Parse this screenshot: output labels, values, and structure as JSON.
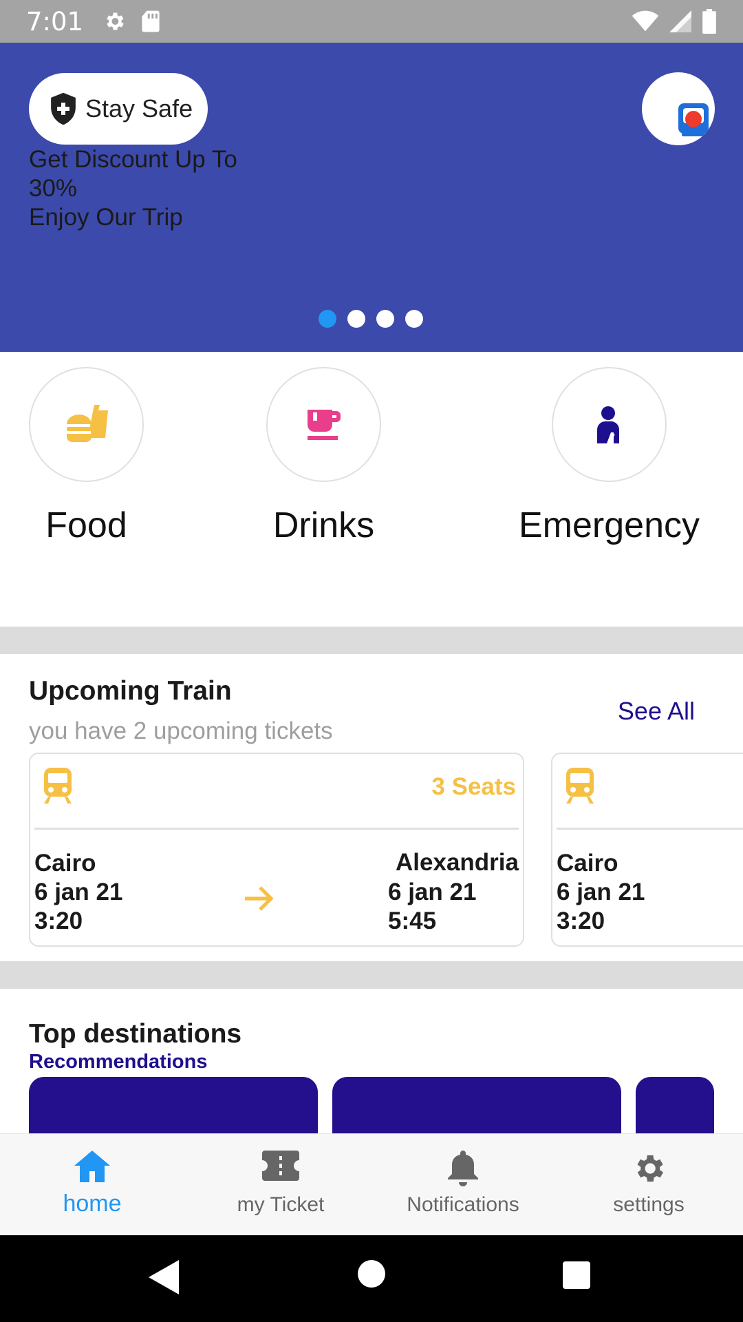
{
  "status_bar": {
    "time": "7:01",
    "icons": [
      "settings-icon",
      "sd-card-icon",
      "wifi-icon",
      "signal-icon",
      "battery-icon"
    ]
  },
  "hero": {
    "stay_safe_label": "Stay Safe",
    "promo_line1": "Get Discount Up To",
    "promo_line2": "30%",
    "promo_line3": "Enjoy Our Trip",
    "slides_total": 4,
    "active_slide": 1,
    "background_color": "#3c4aab"
  },
  "categories": [
    {
      "label": "Food",
      "icon": "food-icon",
      "color": "#f6c044"
    },
    {
      "label": "Drinks",
      "icon": "coffee-cup-icon",
      "color": "#e83e8c"
    },
    {
      "label": "Emergency",
      "icon": "emergency-person-icon",
      "color": "#1e0f8f"
    }
  ],
  "upcoming": {
    "title": "Upcoming Train",
    "subtitle": "you have 2 upcoming tickets",
    "see_all": "See All",
    "tickets": [
      {
        "seats": "3 Seats",
        "from_city": "Cairo",
        "from_date": "6 jan 21",
        "from_time": "3:20",
        "to_city": "Alexandria",
        "to_date": "6 jan 21",
        "to_time": "5:45"
      },
      {
        "seats": "",
        "from_city": "Cairo",
        "from_date": "6 jan 21",
        "from_time": "3:20"
      }
    ]
  },
  "destinations": {
    "title": "Top destinations",
    "subtitle": "Recommendations",
    "card_color": "#240f8c"
  },
  "bottom_nav": {
    "items": [
      {
        "label": "home",
        "icon": "home-icon",
        "active": true
      },
      {
        "label": "my Ticket",
        "icon": "ticket-icon",
        "active": false
      },
      {
        "label": "Notifications",
        "icon": "bell-icon",
        "active": false
      },
      {
        "label": "settings",
        "icon": "gear-icon",
        "active": false
      }
    ],
    "active_color": "#2196f3"
  }
}
